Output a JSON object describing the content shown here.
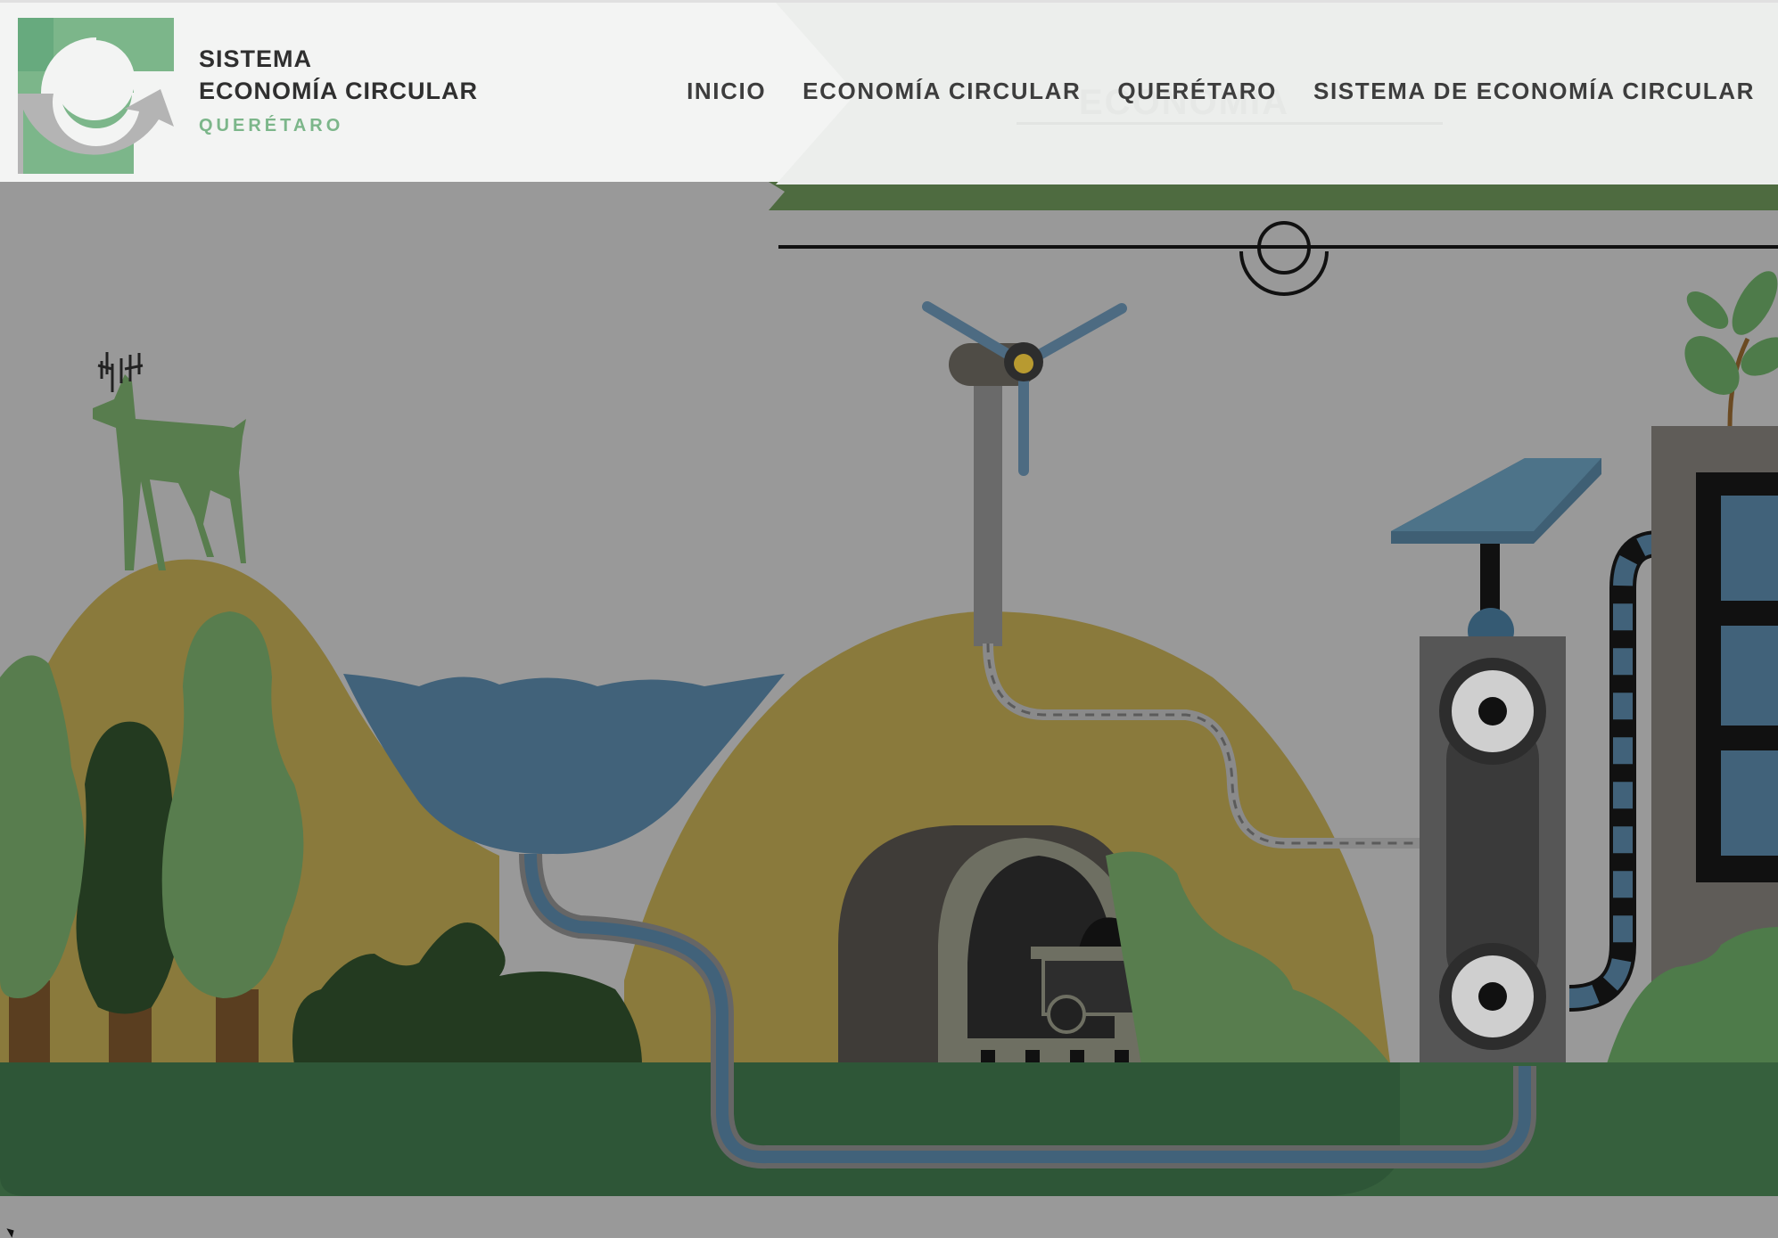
{
  "header": {
    "brand": {
      "line1": "SISTEMA",
      "line2": "ECONOMÍA CIRCULAR",
      "line3": "QUERÉTARO"
    },
    "nav": [
      {
        "label": "INICIO"
      },
      {
        "label": "ECONOMÍA CIRCULAR"
      },
      {
        "label": "QUERÉTARO"
      },
      {
        "label": "SISTEMA DE ECONOMÍA CIRCULAR"
      }
    ],
    "ghost_text": "ECONOMÍA"
  },
  "colors": {
    "brand_green": "#7cb68a",
    "logo_gray": "#b4b4b4",
    "header_bg": "#f3f4f3",
    "nav_text": "#3d3d3d",
    "hill_mustard": "#8a7a3c",
    "lake_blue": "#41627a",
    "grass_green": "#36603d"
  },
  "hero": {
    "icons": [
      "deer-icon",
      "wind-turbine-icon",
      "solar-panel-icon",
      "mine-cart-icon",
      "tree-icon",
      "sprout-icon"
    ]
  }
}
